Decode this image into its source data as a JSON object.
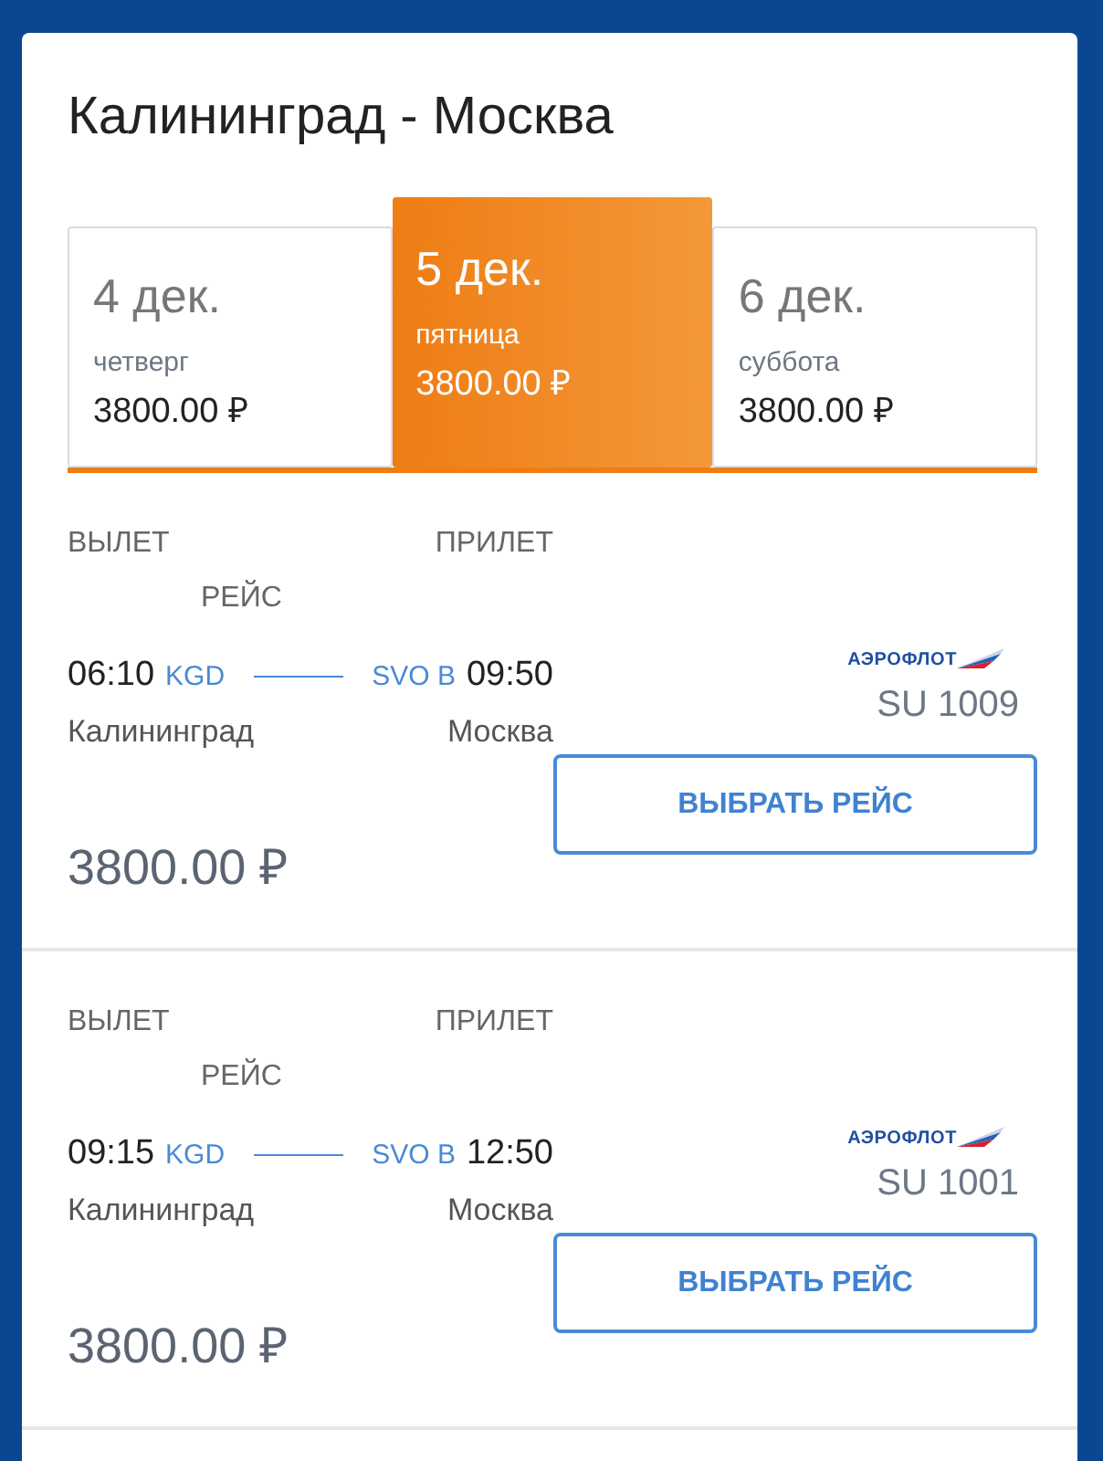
{
  "title": "Калининград - Москва",
  "dates": [
    {
      "date": "4 дек.",
      "weekday": "четверг",
      "price": "3800.00 ₽",
      "selected": false
    },
    {
      "date": "5 дек.",
      "weekday": "пятница",
      "price": "3800.00 ₽",
      "selected": true
    },
    {
      "date": "6 дек.",
      "weekday": "суббота",
      "price": "3800.00 ₽",
      "selected": false
    }
  ],
  "flights": [
    {
      "departure_label": "ВЫЛЕТ",
      "arrival_label": "ПРИЛЕТ",
      "flight_label": "РЕЙС",
      "departure_time": "06:10",
      "departure_code": "KGD",
      "arrival_code": "SVO B",
      "arrival_time": "09:50",
      "departure_city": "Калининград",
      "arrival_city": "Москва",
      "airline": "АЭРОФЛОТ",
      "flight_number": "SU 1009",
      "price": "3800.00 ₽",
      "button": "ВЫБРАТЬ РЕЙС"
    },
    {
      "departure_label": "ВЫЛЕТ",
      "arrival_label": "ПРИЛЕТ",
      "flight_label": "РЕЙС",
      "departure_time": "09:15",
      "departure_code": "KGD",
      "arrival_code": "SVO B",
      "arrival_time": "12:50",
      "departure_city": "Калининград",
      "arrival_city": "Москва",
      "airline": "АЭРОФЛОТ",
      "flight_number": "SU 1001",
      "price": "3800.00 ₽",
      "button": "ВЫБРАТЬ РЕЙС"
    }
  ]
}
